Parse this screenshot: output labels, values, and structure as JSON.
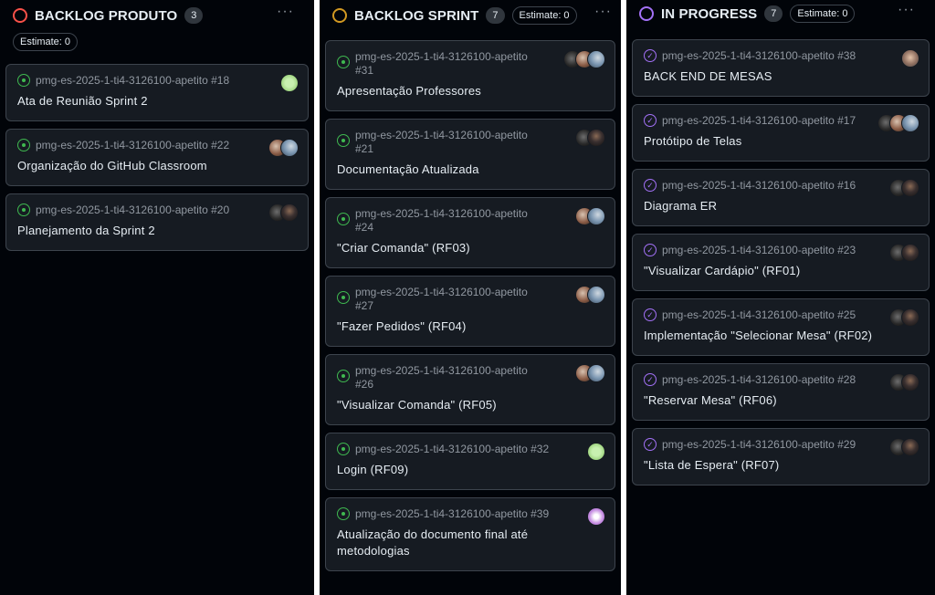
{
  "columns": [
    {
      "title": "BACKLOG PRODUTO",
      "count": "3",
      "status_color": "#f85149",
      "estimate": "Estimate: 0",
      "cards": [
        {
          "repo": "pmg-es-2025-1-ti4-3126100-apetito #18",
          "title": "Ata de Reunião Sprint 2",
          "icon": "open-issue-icon",
          "avatars": [
            "av-green"
          ]
        },
        {
          "repo": "pmg-es-2025-1-ti4-3126100-apetito #22",
          "title": "Organização do GitHub Classroom",
          "icon": "open-issue-icon",
          "avatars": [
            "av-photo-a",
            "av-photo-b"
          ]
        },
        {
          "repo": "pmg-es-2025-1-ti4-3126100-apetito #20",
          "title": "Planejamento da Sprint 2",
          "icon": "open-issue-icon",
          "avatars": [
            "av-dark2",
            "av-dark"
          ]
        }
      ]
    },
    {
      "title": "BACKLOG SPRINT",
      "count": "7",
      "status_color": "#d29922",
      "estimate": "Estimate: 0",
      "cards": [
        {
          "repo": "pmg-es-2025-1-ti4-3126100-apetito",
          "num": "#31",
          "title": "Apresentação Professores",
          "icon": "open-issue-icon",
          "avatars": [
            "av-dark2",
            "av-photo-a",
            "av-photo-b"
          ]
        },
        {
          "repo": "pmg-es-2025-1-ti4-3126100-apetito",
          "num": "#21",
          "title": "Documentação Atualizada",
          "icon": "open-issue-icon",
          "avatars": [
            "av-dark2",
            "av-dark"
          ]
        },
        {
          "repo": "pmg-es-2025-1-ti4-3126100-apetito",
          "num": "#24",
          "title": "\"Criar Comanda\" (RF03)",
          "icon": "open-issue-icon",
          "avatars": [
            "av-photo-a",
            "av-photo-b"
          ]
        },
        {
          "repo": "pmg-es-2025-1-ti4-3126100-apetito",
          "num": "#27",
          "title": "\"Fazer Pedidos\" (RF04)",
          "icon": "open-issue-icon",
          "avatars": [
            "av-photo-a",
            "av-photo-b"
          ]
        },
        {
          "repo": "pmg-es-2025-1-ti4-3126100-apetito",
          "num": "#26",
          "title": "\"Visualizar Comanda\" (RF05)",
          "icon": "open-issue-icon",
          "avatars": [
            "av-photo-a",
            "av-photo-b"
          ]
        },
        {
          "repo": "pmg-es-2025-1-ti4-3126100-apetito #32",
          "title": "Login (RF09)",
          "icon": "open-issue-icon",
          "avatars": [
            "av-green"
          ]
        },
        {
          "repo": "pmg-es-2025-1-ti4-3126100-apetito #39",
          "title": "Atualização do documento final até metodologias",
          "icon": "open-issue-icon",
          "avatars": [
            "av-pixel"
          ]
        }
      ]
    },
    {
      "title": "IN PROGRESS",
      "count": "7",
      "status_color": "#a371f7",
      "estimate": "Estimate: 0",
      "cards": [
        {
          "repo": "pmg-es-2025-1-ti4-3126100-apetito #38",
          "title": "BACK END DE MESAS",
          "icon": "check-circle-icon",
          "avatars": [
            "av-man"
          ]
        },
        {
          "repo": "pmg-es-2025-1-ti4-3126100-apetito #17",
          "title": "Protótipo de Telas",
          "icon": "check-circle-icon",
          "avatars": [
            "av-dark2",
            "av-photo-a",
            "av-photo-b"
          ]
        },
        {
          "repo": "pmg-es-2025-1-ti4-3126100-apetito #16",
          "title": "Diagrama ER",
          "icon": "check-circle-icon",
          "avatars": [
            "av-dark2",
            "av-dark"
          ]
        },
        {
          "repo": "pmg-es-2025-1-ti4-3126100-apetito #23",
          "title": "\"Visualizar Cardápio\" (RF01)",
          "icon": "check-circle-icon",
          "avatars": [
            "av-dark2",
            "av-dark"
          ]
        },
        {
          "repo": "pmg-es-2025-1-ti4-3126100-apetito #25",
          "title": "Implementação \"Selecionar Mesa\" (RF02)",
          "icon": "check-circle-icon",
          "avatars": [
            "av-dark2",
            "av-dark"
          ]
        },
        {
          "repo": "pmg-es-2025-1-ti4-3126100-apetito #28",
          "title": "\"Reservar Mesa\" (RF06)",
          "icon": "check-circle-icon",
          "avatars": [
            "av-dark2",
            "av-dark"
          ]
        },
        {
          "repo": "pmg-es-2025-1-ti4-3126100-apetito #29",
          "title": "\"Lista de Espera\" (RF07)",
          "icon": "check-circle-icon",
          "avatars": [
            "av-dark2",
            "av-dark"
          ]
        }
      ]
    }
  ],
  "ui": {
    "menu_icon": "ellipsis-icon",
    "menu_glyph": "···"
  }
}
